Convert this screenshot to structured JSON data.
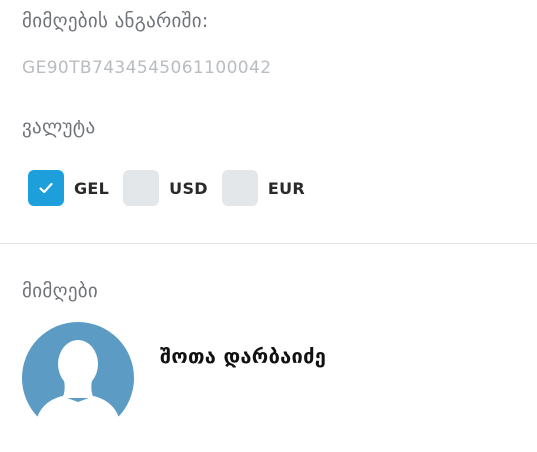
{
  "account": {
    "label": "მიმღების ანგარიში:",
    "value": "GE90TB7434545061100042"
  },
  "currency": {
    "label": "ვალუტა",
    "options": [
      {
        "code": "GEL",
        "checked": true
      },
      {
        "code": "USD",
        "checked": false
      },
      {
        "code": "EUR",
        "checked": false
      }
    ]
  },
  "recipients": {
    "label": "მიმღები",
    "name": "შოთა დარბაიძე"
  },
  "colors": {
    "accent": "#1d9fdc",
    "avatar": "#5b9bc4",
    "unchecked": "#e4e7ea"
  },
  "icons": {
    "check": "check-icon",
    "avatar": "user-silhouette-icon"
  }
}
